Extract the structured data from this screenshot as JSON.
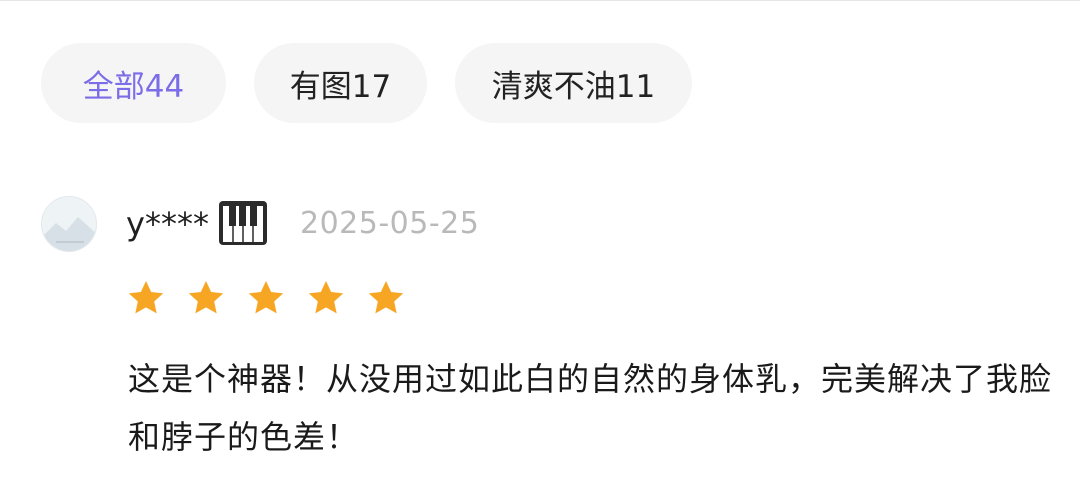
{
  "filters": [
    {
      "label": "全部44",
      "active": true
    },
    {
      "label": "有图17",
      "active": false
    },
    {
      "label": "清爽不油11",
      "active": false
    }
  ],
  "review": {
    "username": "y****",
    "badge_icon": "piano-icon",
    "date": "2025-05-25",
    "rating": 5,
    "max_rating": 5,
    "text": "这是个神器！从没用过如此白的自然的身体乳，完美解决了我脸和脖子的色差！"
  },
  "colors": {
    "accent": "#7b6ce8",
    "chip_bg": "#f5f5f5",
    "star": "#f6a623",
    "date": "#b9b9b9"
  }
}
